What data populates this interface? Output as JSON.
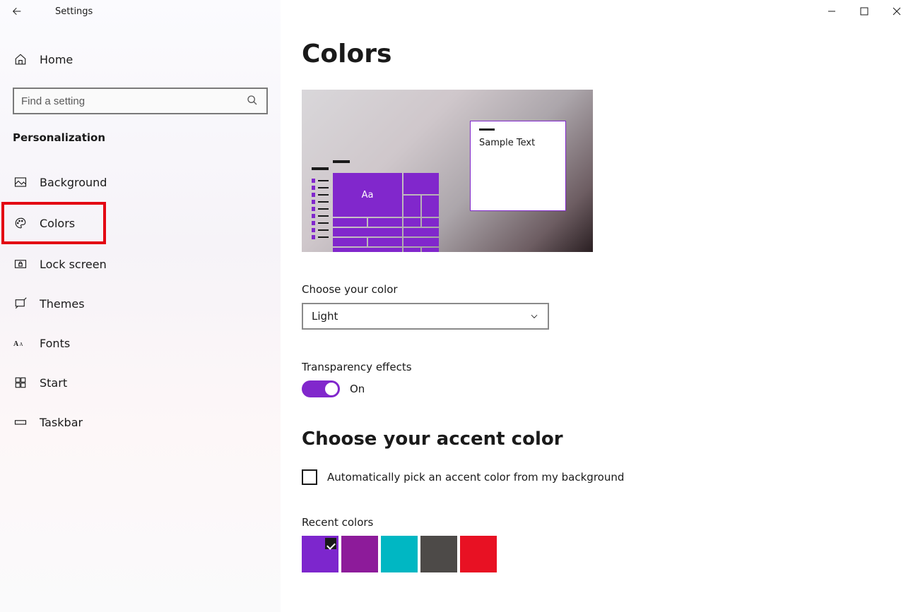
{
  "titlebar": {
    "title": "Settings"
  },
  "sidebar": {
    "home": "Home",
    "search_placeholder": "Find a setting",
    "section": "Personalization",
    "items": [
      {
        "label": "Background"
      },
      {
        "label": "Colors"
      },
      {
        "label": "Lock screen"
      },
      {
        "label": "Themes"
      },
      {
        "label": "Fonts"
      },
      {
        "label": "Start"
      },
      {
        "label": "Taskbar"
      }
    ]
  },
  "main": {
    "title": "Colors",
    "preview": {
      "sample_text": "Sample Text",
      "tile_label": "Aa"
    },
    "choose_color": {
      "label": "Choose your color",
      "value": "Light"
    },
    "transparency": {
      "label": "Transparency effects",
      "state": "On"
    },
    "accent_section": "Choose your accent color",
    "auto_pick": "Automatically pick an accent color from my background",
    "recent_label": "Recent colors",
    "recent_colors": [
      {
        "hex": "#7d26cd",
        "selected": true
      },
      {
        "hex": "#8d1b9a",
        "selected": false
      },
      {
        "hex": "#00b7c3",
        "selected": false
      },
      {
        "hex": "#4d4a48",
        "selected": false
      },
      {
        "hex": "#e81123",
        "selected": false
      }
    ]
  }
}
